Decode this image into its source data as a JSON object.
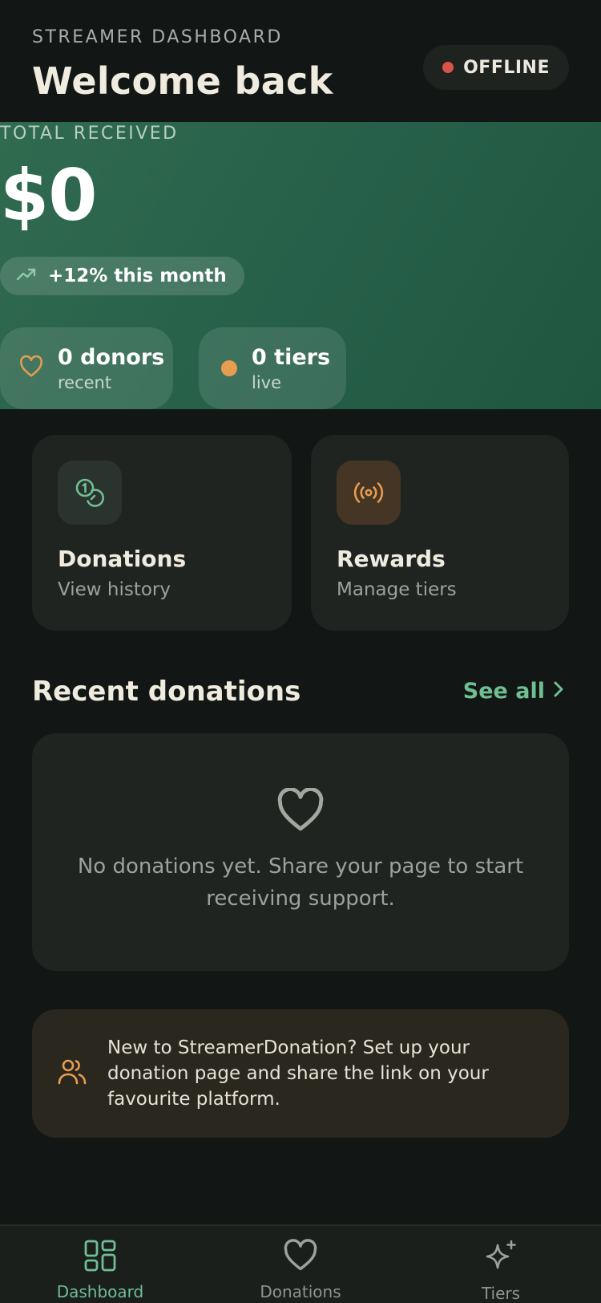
{
  "header": {
    "eyebrow": "STREAMER DASHBOARD",
    "title": "Welcome back",
    "status": "OFFLINE"
  },
  "hero": {
    "label": "TOTAL RECEIVED",
    "amount": "$0",
    "trend": "+12% this month",
    "stats": [
      {
        "value": "0 donors",
        "sub": "recent"
      },
      {
        "value": "0 tiers",
        "sub": "live"
      }
    ]
  },
  "cards": [
    {
      "title": "Donations",
      "subtitle": "View history",
      "icon": "coins-icon"
    },
    {
      "title": "Rewards",
      "subtitle": "Manage tiers",
      "icon": "broadcast-icon"
    }
  ],
  "recent": {
    "title": "Recent donations",
    "see_all": "See all",
    "empty_text": "No donations yet. Share your page to start receiving support."
  },
  "tip": {
    "text": "New to StreamerDonation? Set up your donation page and share the link on your favourite platform."
  },
  "nav": [
    {
      "label": "Dashboard",
      "icon": "grid-icon",
      "active": true
    },
    {
      "label": "Donations",
      "icon": "heart-icon",
      "active": false
    },
    {
      "label": "Tiers",
      "icon": "sparkle-icon",
      "active": false
    }
  ],
  "colors": {
    "background": "#121715",
    "hero_green": "#2b6349",
    "accent_green": "#6fbf93",
    "accent_orange": "#e79d4f",
    "status_red": "#d9534a"
  }
}
